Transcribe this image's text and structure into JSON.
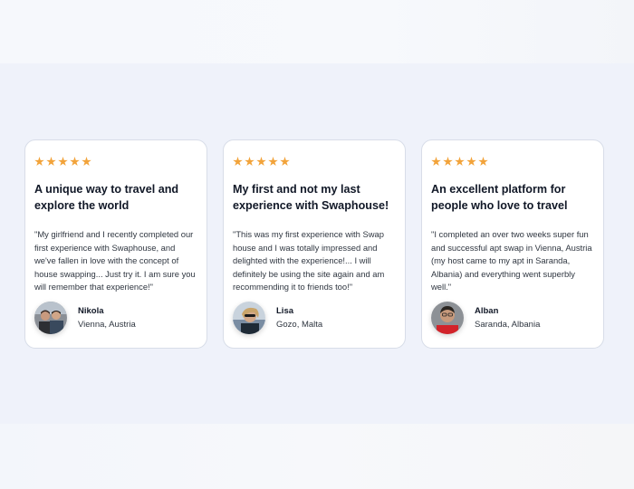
{
  "colors": {
    "star": "#f2a33a",
    "background": "#eff2fa",
    "card": "#ffffff"
  },
  "testimonials": [
    {
      "rating": 5,
      "title": "A unique way to travel and explore the world",
      "quote": "\"My girlfriend and I recently completed our first experience with Swaphouse, and we've fallen in love with the concept of house swapping... Just try it. I am sure you will remember that experience!\"",
      "name": "Nikola",
      "location": "Vienna, Austria"
    },
    {
      "rating": 5,
      "title": "My first and not my last experience with Swaphouse!",
      "quote": "\"This was my first experience with Swap house and I was totally impressed and delighted with the experience!... I will definitely be using the site again and am recommending it to friends too!\"",
      "name": "Lisa",
      "location": "Gozo, Malta"
    },
    {
      "rating": 5,
      "title": "An excellent platform for people who love to travel",
      "quote": "\"I completed an over two weeks super fun and successful apt swap in Vienna, Austria (my host came to my apt in Saranda, Albania) and everything went superbly well.\"",
      "name": "Alban",
      "location": "Saranda, Albania"
    }
  ]
}
